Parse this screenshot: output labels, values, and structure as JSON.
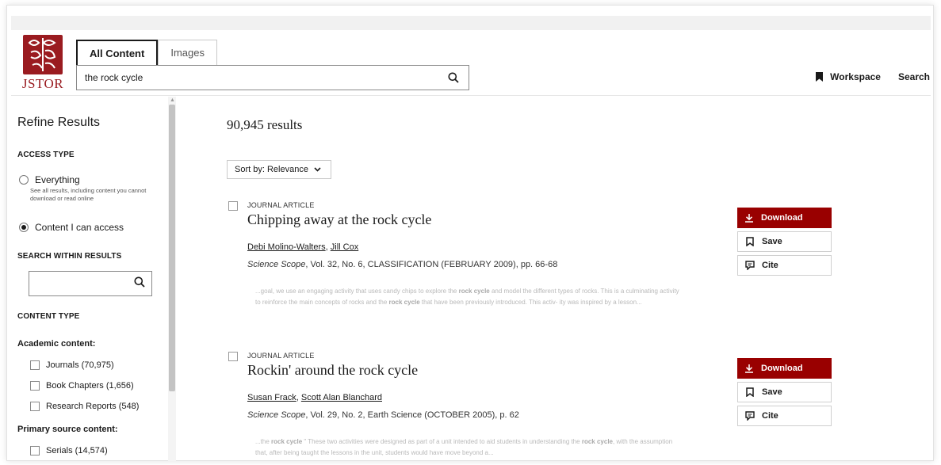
{
  "logo": {
    "text": "JSTOR"
  },
  "tabs": [
    {
      "label": "All Content",
      "active": true
    },
    {
      "label": "Images",
      "active": false
    }
  ],
  "search": {
    "value": "the rock cycle"
  },
  "topnav": {
    "workspace": "Workspace",
    "search": "Search"
  },
  "sidebar": {
    "title": "Refine Results",
    "access_type": {
      "heading": "ACCESS TYPE",
      "everything_label": "Everything",
      "everything_desc": "See all results, including content you cannot download or read online",
      "access_label": "Content I can access",
      "selected": "Content I can access"
    },
    "search_within": {
      "heading": "SEARCH WITHIN RESULTS",
      "value": ""
    },
    "content_type": {
      "heading": "CONTENT TYPE",
      "academic_heading": "Academic content:",
      "academic_items": [
        "Journals (70,975)",
        "Book Chapters (1,656)",
        "Research Reports (548)"
      ],
      "primary_heading": "Primary source content:",
      "primary_items": [
        "Serials (14,574)"
      ]
    }
  },
  "results": {
    "count": "90,945 results",
    "sort_label": "Sort by: Relevance",
    "items": [
      {
        "type": "JOURNAL ARTICLE",
        "title": "Chipping away at the rock cycle",
        "author1": "Debi Molino-Walters",
        "author2": "Jill Cox",
        "journal": "Science Scope",
        "citation": ", Vol. 32, No. 6, CLASSIFICATION (FEBRUARY 2009), pp. 66-68",
        "snippet_1": "...goal, we use an engaging activity that uses candy chips to explore the ",
        "snippet_bold_1": "rock cycle",
        "snippet_2": " and model the different types of rocks. This is a culminating activity to reinforce the main concepts of rocks and the ",
        "snippet_bold_2": "rock cycle",
        "snippet_3": " that have been previously introduced. This activ- ity was inspired by a lesson..."
      },
      {
        "type": "JOURNAL ARTICLE",
        "title": "Rockin' around the rock cycle",
        "author1": "Susan Frack",
        "author2": "Scott Alan Blanchard",
        "journal": "Science Scope",
        "citation": ", Vol. 29, No. 2, Earth Science (OCTOBER 2005), p. 62",
        "snippet_1": "...the ",
        "snippet_bold_1": "rock cycle",
        "snippet_2": " \" These two activities were designed as part of a unit intended to aid students in understanding the ",
        "snippet_bold_2": "rock cycle",
        "snippet_3": ", with the assumption that, after being taught the lessons in the unit, students would have move beyond a..."
      }
    ]
  },
  "actions": {
    "download": "Download",
    "save": "Save",
    "cite": "Cite"
  },
  "colors": {
    "brand": "#990000",
    "logo": "#9a1b20"
  }
}
